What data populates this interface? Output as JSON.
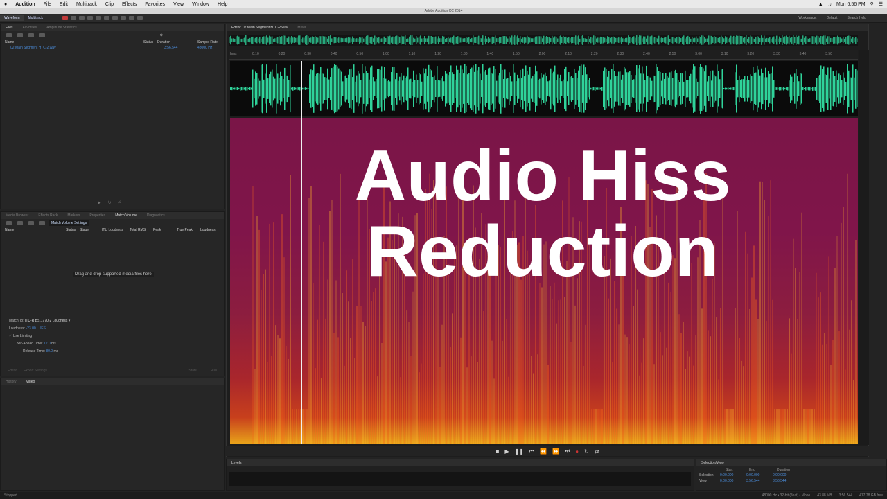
{
  "menubar": {
    "apple": "",
    "app": "Audition",
    "items": [
      "File",
      "Edit",
      "Multitrack",
      "Clip",
      "Effects",
      "Favorites",
      "View",
      "Window",
      "Help"
    ],
    "clock": "Mon 6:56 PM"
  },
  "window_title": "Adobe Audition CC 2014",
  "toolbar": {
    "waveform": "Waveform",
    "multitrack": "Multitrack",
    "workspace_label": "Workspace:",
    "workspace_value": "Default",
    "search_help": "Search Help"
  },
  "files_panel": {
    "tabs": [
      "Files",
      "Favorites",
      "Amplitude Statistics"
    ],
    "columns": {
      "name": "Name",
      "status": "Status",
      "duration": "Duration",
      "sample_rate": "Sample Rate"
    },
    "file": {
      "name": "02 Main Segment HTC-2.wav",
      "duration": "3:56.544",
      "sample_rate": "48000 Hz"
    }
  },
  "mid_panel": {
    "tabs": [
      "Media Browser",
      "Effects Rack",
      "Markers",
      "Properties",
      "Match Volume",
      "Diagnostics"
    ],
    "settings_tip": "Match Volume Settings",
    "columns": [
      "Name",
      "Status",
      "Stage",
      "ITU Loudness",
      "Total RMS",
      "Peak",
      "True Peak",
      "Loudness"
    ],
    "drop_hint": "Drag and drop supported media files here",
    "match_to_label": "Match To:",
    "match_to_value": "ITU-R BS.1770-2 Loudness",
    "loudness_label": "Loudness:",
    "loudness_value": "-23.00 LUFS",
    "use_limiting": "Use Limiting",
    "lookahead_label": "Look-Ahead Time:",
    "lookahead_value": "12.0",
    "release_label": "Release Time:",
    "release_value": "80.0",
    "ms": "ms",
    "bottom_left": [
      "Editor",
      "Export Settings"
    ],
    "bottom_right": [
      "Stats",
      "Run"
    ]
  },
  "history_panel": {
    "tabs": [
      "History",
      "Video"
    ]
  },
  "editor": {
    "tab_label": "Editor: 02 Main Segment HTC-2.wav",
    "tab_mixer": "Mixer",
    "ruler_unit": "hms",
    "ruler_ticks": [
      "0:10",
      "0:20",
      "0:30",
      "0:40",
      "0:50",
      "1:00",
      "1:10",
      "1:20",
      "1:30",
      "1:40",
      "1:50",
      "2:00",
      "2:10",
      "2:20",
      "2:30",
      "2:40",
      "2:50",
      "3:00",
      "3:10",
      "3:20",
      "3:30",
      "3:40",
      "3:50"
    ]
  },
  "overlay": {
    "line1": "Audio Hiss",
    "line2": "Reduction"
  },
  "levels": {
    "title": "Levels"
  },
  "selection_view": {
    "title": "Selection/View",
    "columns": [
      "Start",
      "End",
      "Duration"
    ],
    "rows": [
      {
        "label": "Selection",
        "start": "0:00.000",
        "end": "0:00.000",
        "duration": "0:00.000"
      },
      {
        "label": "View",
        "start": "0:00.000",
        "end": "3:56.544",
        "duration": "3:56.544"
      }
    ]
  },
  "status": {
    "left": "Stopped",
    "info": "48000 Hz • 32-bit (float) • Mono",
    "size": "43.88 MB",
    "duration": "3:56.544",
    "free": "417.78 GB free"
  },
  "colors": {
    "wave": "#2fd39a",
    "spectro_top": "#7a1547",
    "spectro_bottom": "#e8a21a",
    "accent": "#4a8bd8"
  }
}
